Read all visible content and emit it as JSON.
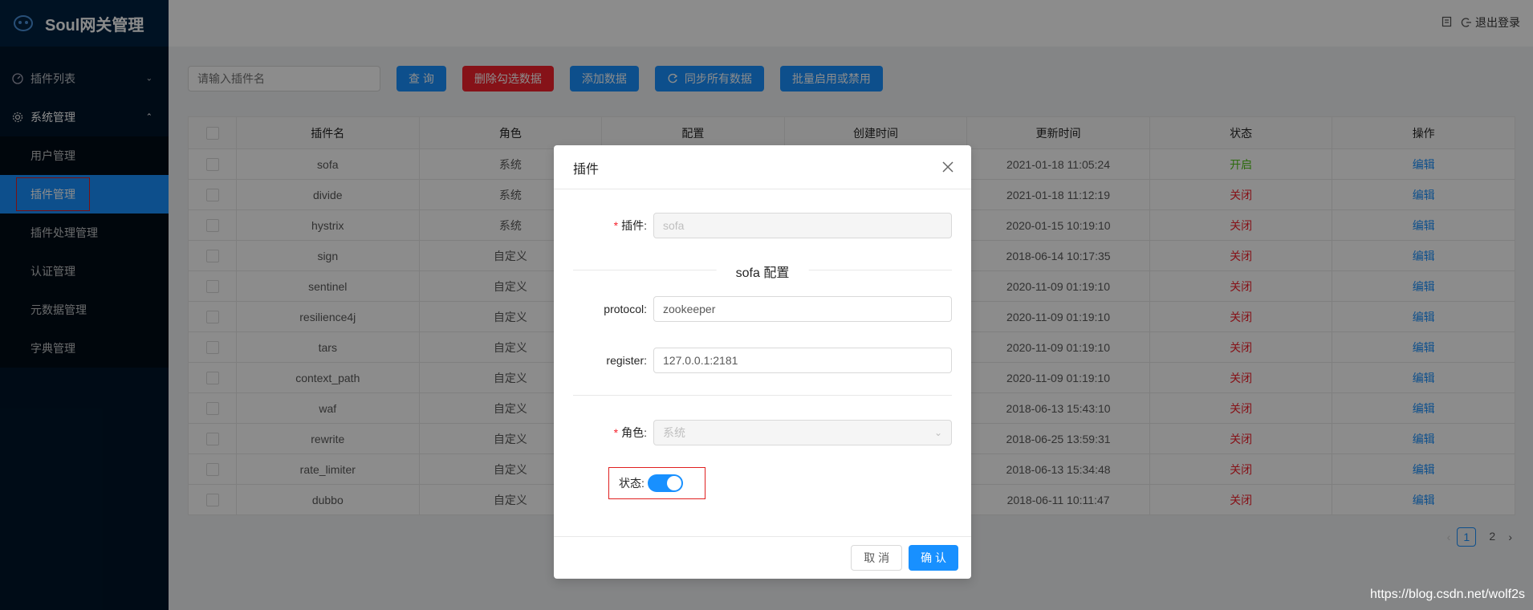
{
  "app": {
    "title": "Soul网关管理"
  },
  "header": {
    "logout": "退出登录"
  },
  "sidebar": {
    "plugin_list": "插件列表",
    "system_manage": "系统管理",
    "items": [
      {
        "label": "用户管理"
      },
      {
        "label": "插件管理"
      },
      {
        "label": "插件处理管理"
      },
      {
        "label": "认证管理"
      },
      {
        "label": "元数据管理"
      },
      {
        "label": "字典管理"
      }
    ]
  },
  "toolbar": {
    "search_placeholder": "请输入插件名",
    "query": "查 询",
    "delete_selected": "删除勾选数据",
    "add": "添加数据",
    "sync_all": "同步所有数据",
    "batch_toggle": "批量启用或禁用"
  },
  "table": {
    "headers": [
      "插件名",
      "角色",
      "配置",
      "创建时间",
      "更新时间",
      "状态",
      "操作"
    ],
    "rows": [
      {
        "name": "sofa",
        "role": "系统",
        "updated": "2021-01-18 11:05:24",
        "status": "开启",
        "action": "编辑"
      },
      {
        "name": "divide",
        "role": "系统",
        "updated": "2021-01-18 11:12:19",
        "status": "关闭",
        "action": "编辑"
      },
      {
        "name": "hystrix",
        "role": "系统",
        "updated": "2020-01-15 10:19:10",
        "status": "关闭",
        "action": "编辑"
      },
      {
        "name": "sign",
        "role": "自定义",
        "updated": "2018-06-14 10:17:35",
        "status": "关闭",
        "action": "编辑"
      },
      {
        "name": "sentinel",
        "role": "自定义",
        "updated": "2020-11-09 01:19:10",
        "status": "关闭",
        "action": "编辑"
      },
      {
        "name": "resilience4j",
        "role": "自定义",
        "updated": "2020-11-09 01:19:10",
        "status": "关闭",
        "action": "编辑"
      },
      {
        "name": "tars",
        "role": "自定义",
        "updated": "2020-11-09 01:19:10",
        "status": "关闭",
        "action": "编辑"
      },
      {
        "name": "context_path",
        "role": "自定义",
        "updated": "2020-11-09 01:19:10",
        "status": "关闭",
        "action": "编辑"
      },
      {
        "name": "waf",
        "role": "自定义",
        "updated": "2018-06-13 15:43:10",
        "status": "关闭",
        "action": "编辑"
      },
      {
        "name": "rewrite",
        "role": "自定义",
        "updated": "2018-06-25 13:59:31",
        "status": "关闭",
        "action": "编辑"
      },
      {
        "name": "rate_limiter",
        "role": "自定义",
        "updated": "2018-06-13 15:34:48",
        "status": "关闭",
        "action": "编辑"
      },
      {
        "name": "dubbo",
        "role": "自定义",
        "updated": "2018-06-11 10:11:47",
        "status": "关闭",
        "action": "编辑"
      }
    ]
  },
  "pagination": {
    "pages": [
      "1",
      "2"
    ],
    "current": "1"
  },
  "modal": {
    "title": "插件",
    "plugin_label": "插件:",
    "plugin_value": "sofa",
    "section_title": "sofa 配置",
    "protocol_label": "protocol:",
    "protocol_value": "zookeeper",
    "register_label": "register:",
    "register_value": "127.0.0.1:2181",
    "role_label": "角色:",
    "role_value": "系统",
    "status_label": "状态:",
    "status_on": true,
    "cancel": "取 消",
    "confirm": "确 认"
  },
  "watermark": "https://blog.csdn.net/wolf2s",
  "colors": {
    "primary": "#1890ff",
    "danger": "#f5222d",
    "success": "#52c41a",
    "sidebar": "#001529"
  }
}
